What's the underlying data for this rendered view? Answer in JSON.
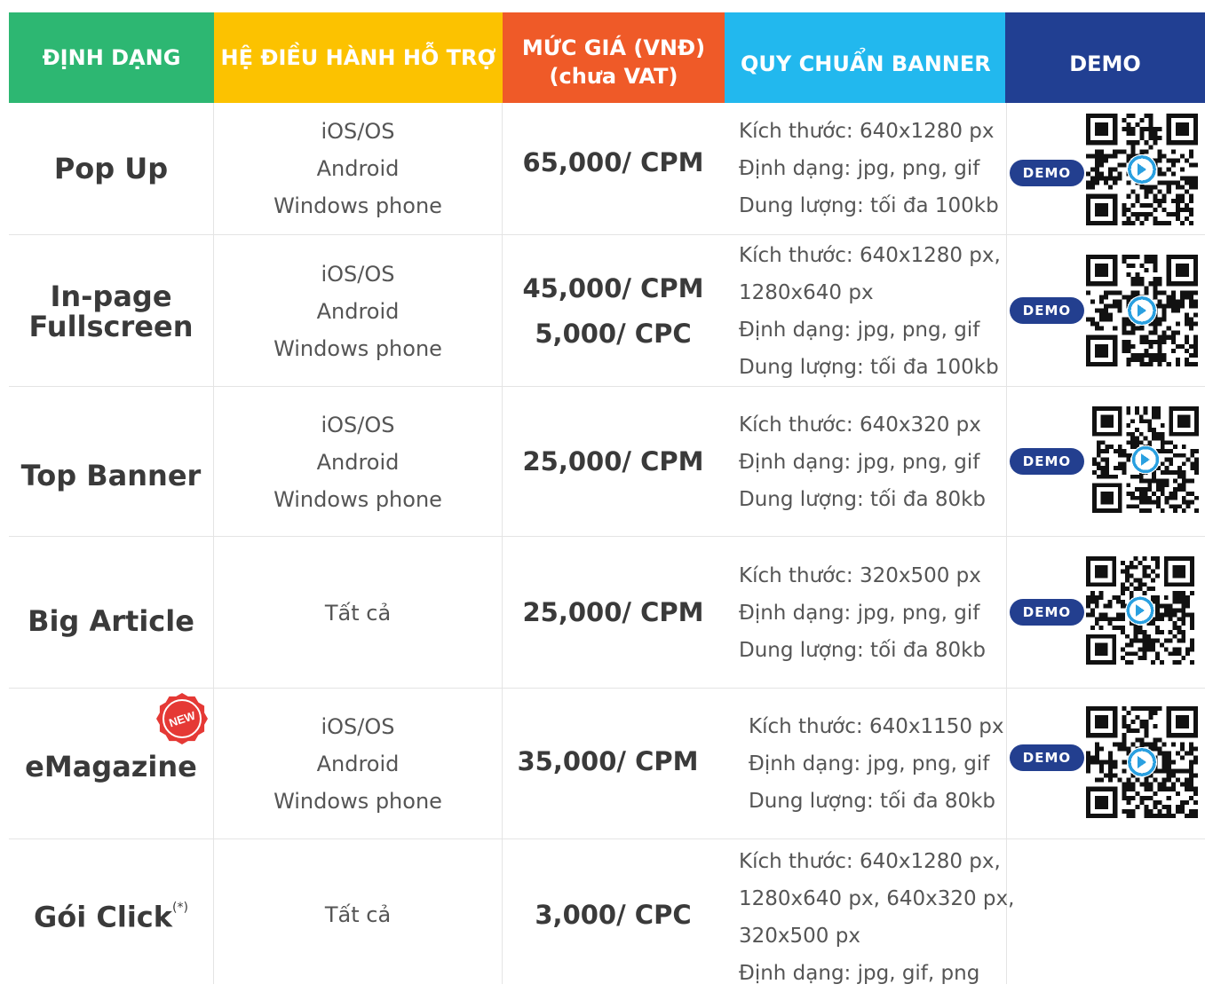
{
  "header": {
    "format": "ĐỊNH DẠNG",
    "os": "HỆ ĐIỀU HÀNH HỖ TRỢ",
    "price_line1": "MỨC GIÁ (VNĐ)",
    "price_line2": "(chưa VAT)",
    "spec": "QUY CHUẨN BANNER",
    "demo": "DEMO"
  },
  "colors": {
    "header_format": "#2db772",
    "header_os": "#fcc200",
    "header_price": "#ef5a28",
    "header_spec": "#22b8ee",
    "header_demo": "#213f92",
    "demo_button": "#233f8f",
    "new_badge": "#e53935",
    "qr_center": "#2aa0e0"
  },
  "rows": [
    {
      "name_line1": "Pop Up",
      "name_line2": "",
      "os": [
        "iOS/OS",
        "Android",
        "Windows phone"
      ],
      "price": [
        "65,000/ CPM"
      ],
      "spec": [
        "Kích thước: 640x1280 px",
        "Định dạng: jpg, png, gif",
        "Dung lượng: tối đa 100kb"
      ],
      "demo_label": "DEMO",
      "demo_icon": "qr-code-icon"
    },
    {
      "name_line1": "In-page",
      "name_line2": "Fullscreen",
      "os": [
        "iOS/OS",
        "Android",
        "Windows phone"
      ],
      "price": [
        "45,000/ CPM",
        "5,000/ CPC"
      ],
      "spec": [
        "Kích thước: 640x1280 px,",
        "1280x640 px",
        "Định dạng: jpg, png, gif",
        "Dung lượng: tối đa 100kb"
      ],
      "demo_label": "DEMO",
      "demo_icon": "qr-code-icon"
    },
    {
      "name_line1": "Top Banner",
      "name_line2": "",
      "os": [
        "iOS/OS",
        "Android",
        "Windows phone"
      ],
      "price": [
        "25,000/ CPM"
      ],
      "spec": [
        "Kích thước: 640x320 px",
        "Định dạng: jpg, png, gif",
        "Dung lượng: tối đa 80kb"
      ],
      "demo_label": "DEMO",
      "demo_icon": "qr-code-icon"
    },
    {
      "name_line1": "Big Article",
      "name_line2": "",
      "os": [
        "Tất cả"
      ],
      "price": [
        "25,000/ CPM"
      ],
      "spec": [
        "Kích thước: 320x500 px",
        "Định dạng: jpg, png, gif",
        "Dung lượng: tối đa 80kb"
      ],
      "demo_label": "DEMO",
      "demo_icon": "qr-code-icon"
    },
    {
      "name_line1": "eMagazine",
      "name_line2": "",
      "badge": "NEW",
      "os": [
        "iOS/OS",
        "Android",
        "Windows phone"
      ],
      "price": [
        "35,000/ CPM"
      ],
      "spec": [
        "Kích thước: 640x1150 px",
        "Định dạng: jpg, png, gif",
        "Dung lượng: tối đa 80kb"
      ],
      "demo_label": "DEMO",
      "demo_icon": "qr-code-icon"
    },
    {
      "name_line1": "Gói Click",
      "name_line2": "",
      "name_sup": "(*)",
      "os": [
        "Tất cả"
      ],
      "price": [
        "3,000/ CPC"
      ],
      "spec": [
        "Kích thước: 640x1280 px,",
        "1280x640 px, 640x320 px,",
        "320x500 px",
        "Định dạng: jpg, gif, png"
      ]
    }
  ]
}
